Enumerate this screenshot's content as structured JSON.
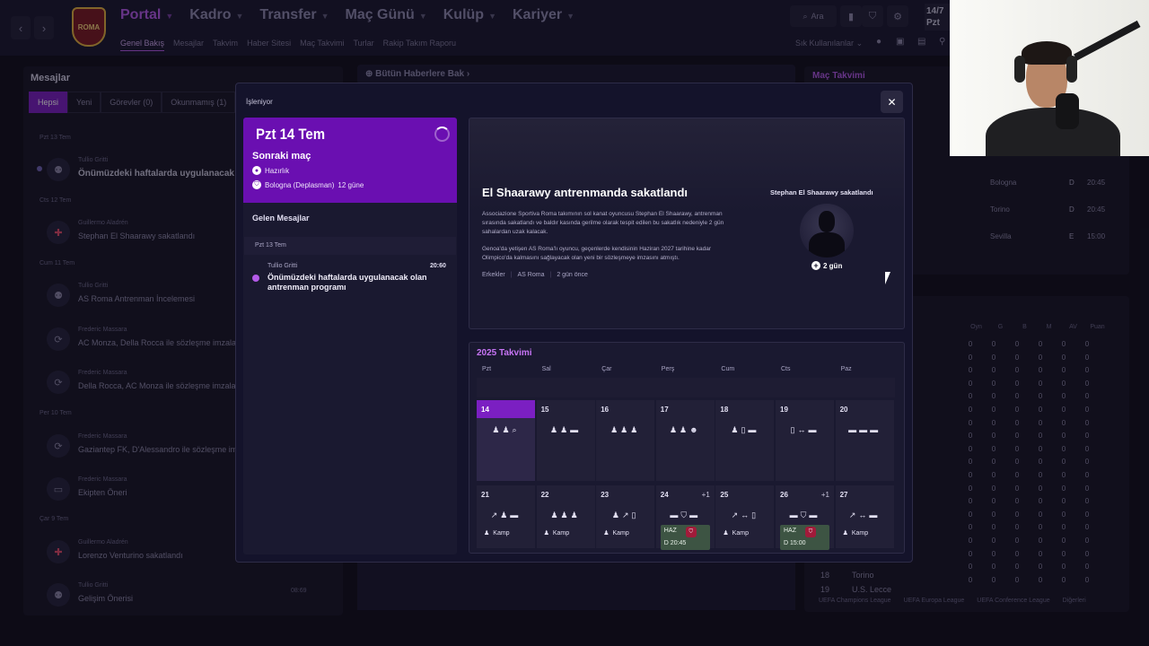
{
  "topnav": {
    "back_icon": "chevron-left",
    "forward_icon": "chevron-right",
    "club_badge_text": "ROMA",
    "items": [
      "Portal",
      "Kadro",
      "Transfer",
      "Maç Günü",
      "Kulüp",
      "Kariyer"
    ],
    "subnav": [
      "Genel Bakış",
      "Mesajlar",
      "Takvim",
      "Haber Sitesi",
      "Maç Takvimi",
      "Turlar",
      "Rakip Takım Raporu"
    ],
    "search_label": "Ara",
    "date_line1": "14/7",
    "date_line2": "Pzt",
    "quick_label": "Sık Kullanılanlar"
  },
  "messages_panel": {
    "title": "Mesajlar",
    "tabs": [
      "Hepsi",
      "Yeni",
      "Görevler (0)",
      "Okunmamış (1)"
    ],
    "groups": [
      {
        "date": "Pzt 13 Tem",
        "from": "Tullio Gritti",
        "subject": "Önümüzdeki haftalarda uygulanacak ol",
        "icon": "people-icon",
        "unread": true
      },
      {
        "date": "Cts 12 Tem",
        "from": "Guillermo Aladrén",
        "subject": "Stephan El Shaarawy sakatlandı",
        "icon": "medical-cross-icon",
        "unread": false
      },
      {
        "date": "Cum 11 Tem",
        "from": "Tullio Gritti",
        "subject": "AS Roma Antrenman İncelemesi",
        "icon": "people-icon",
        "unread": false
      },
      {
        "date": "",
        "from": "Frederic Massara",
        "subject": "AC Monza, Della Rocca ile sözleşme imzaladı",
        "icon": "refresh-icon",
        "unread": false
      },
      {
        "date": "",
        "from": "Frederic Massara",
        "subject": "Della Rocca, AC Monza ile sözleşme imzalamay",
        "icon": "refresh-icon",
        "unread": false
      },
      {
        "date": "Per 10 Tem",
        "from": "Frederic Massara",
        "subject": "Gaziantep FK, D'Alessandro ile sözleşme imzaladı",
        "icon": "refresh-icon",
        "unread": false
      },
      {
        "date": "",
        "from": "Frederic Massara",
        "subject": "Ekipten Öneri",
        "icon": "briefcase-icon",
        "unread": false
      },
      {
        "date": "Çar 9 Tem",
        "from": "Guillermo Aladrén",
        "subject": "Lorenzo Venturino sakatlandı",
        "icon": "medical-cross-icon",
        "unread": false
      },
      {
        "date": "",
        "from": "Tullio Gritti",
        "subject": "Gelişim Önerisi",
        "icon": "people-icon",
        "unread": false
      }
    ],
    "last_time": "08:69"
  },
  "middle_bg": {
    "news_link": "Bütün Haberlere Bak"
  },
  "right_bg": {
    "fixtures_title": "Maç Takvimi",
    "fixtures": [
      {
        "team": "Bologna",
        "venue": "D",
        "time": "20:45"
      },
      {
        "team": "Torino",
        "venue": "D",
        "time": "20:45"
      },
      {
        "team": "Sevilla",
        "venue": "E",
        "time": "15:00"
      }
    ],
    "table_headers": [
      "Oyn",
      "G",
      "B",
      "M",
      "AV",
      "Puan"
    ],
    "table_bottom": [
      {
        "rank": "18",
        "team": "Torino"
      },
      {
        "rank": "19",
        "team": "U.S. Lecce"
      }
    ],
    "competitions": [
      "UEFA Champions League",
      "UEFA Europa League",
      "UEFA Conference League",
      "Diğerleri"
    ]
  },
  "modal": {
    "title": "İşleniyor",
    "close_icon": "close-icon",
    "next_match": {
      "date": "Pzt 14 Tem",
      "label": "Sonraki maç",
      "line1": "Hazırlık",
      "line2_team": "Bologna (Deplasman)",
      "line2_days": "12 güne"
    },
    "inbox": {
      "title": "Gelen Mesajlar",
      "date": "Pzt 13 Tem",
      "from": "Tullio Gritti",
      "time": "20:60",
      "subject": "Önümüzdeki haftalarda uygulanacak olan antrenman programı"
    },
    "news": {
      "headline": "El Shaarawy antrenmanda sakatlandı",
      "para1": "Associazione Sportiva Roma takımının sol kanat oyuncusu Stephan El Shaarawy, antrenman sırasında sakatlandı ve baldır kasında gerilme olarak tespit edilen bu sakatlık nedeniyle 2 gün sahalardan uzak kalacak.",
      "para2": "Genoa'da yetişen AS Roma'lı oyuncu, geçenlerde kendisinin Haziran 2027 tarihine kadar Olimpico'da kalmasını sağlayacak olan yeni bir sözleşmeye imzasını atmıştı.",
      "tags": [
        "Erkekler",
        "AS Roma",
        "2 gün önce"
      ],
      "injury_title": "Stephan El Shaarawy sakatlandı",
      "injury_days": "2 gün"
    },
    "calendar": {
      "title": "2025 Takvimi",
      "days_of_week": [
        "Pzt",
        "Sal",
        "Çar",
        "Perş",
        "Cum",
        "Cts",
        "Paz"
      ],
      "week1": [
        {
          "num": "14",
          "icons": "♟♟⌕",
          "selected": true
        },
        {
          "num": "15",
          "icons": "♟♟▬"
        },
        {
          "num": "16",
          "icons": "♟♟♟"
        },
        {
          "num": "17",
          "icons": "♟♟☻"
        },
        {
          "num": "18",
          "icons": "♟▯▬"
        },
        {
          "num": "19",
          "icons": "▯↔▬"
        },
        {
          "num": "20",
          "icons": "▬▬▬"
        }
      ],
      "week2": [
        {
          "num": "21",
          "icons": "↗♟▬",
          "tag": "Kamp"
        },
        {
          "num": "22",
          "icons": "♟♟♟",
          "tag": "Kamp"
        },
        {
          "num": "23",
          "icons": "♟↗▯",
          "tag": "Kamp"
        },
        {
          "num": "24",
          "icons": "▬⛉▬",
          "plus": "+1",
          "match": {
            "haz": "HAZ",
            "venue": "D",
            "time": "20:45"
          }
        },
        {
          "num": "25",
          "icons": "↗↔▯",
          "tag": "Kamp"
        },
        {
          "num": "26",
          "icons": "▬⛉▬",
          "plus": "+1",
          "match": {
            "haz": "HAZ",
            "venue": "D",
            "time": "15:00"
          }
        },
        {
          "num": "27",
          "icons": "↗↔▬",
          "tag": "Kamp"
        }
      ]
    }
  }
}
